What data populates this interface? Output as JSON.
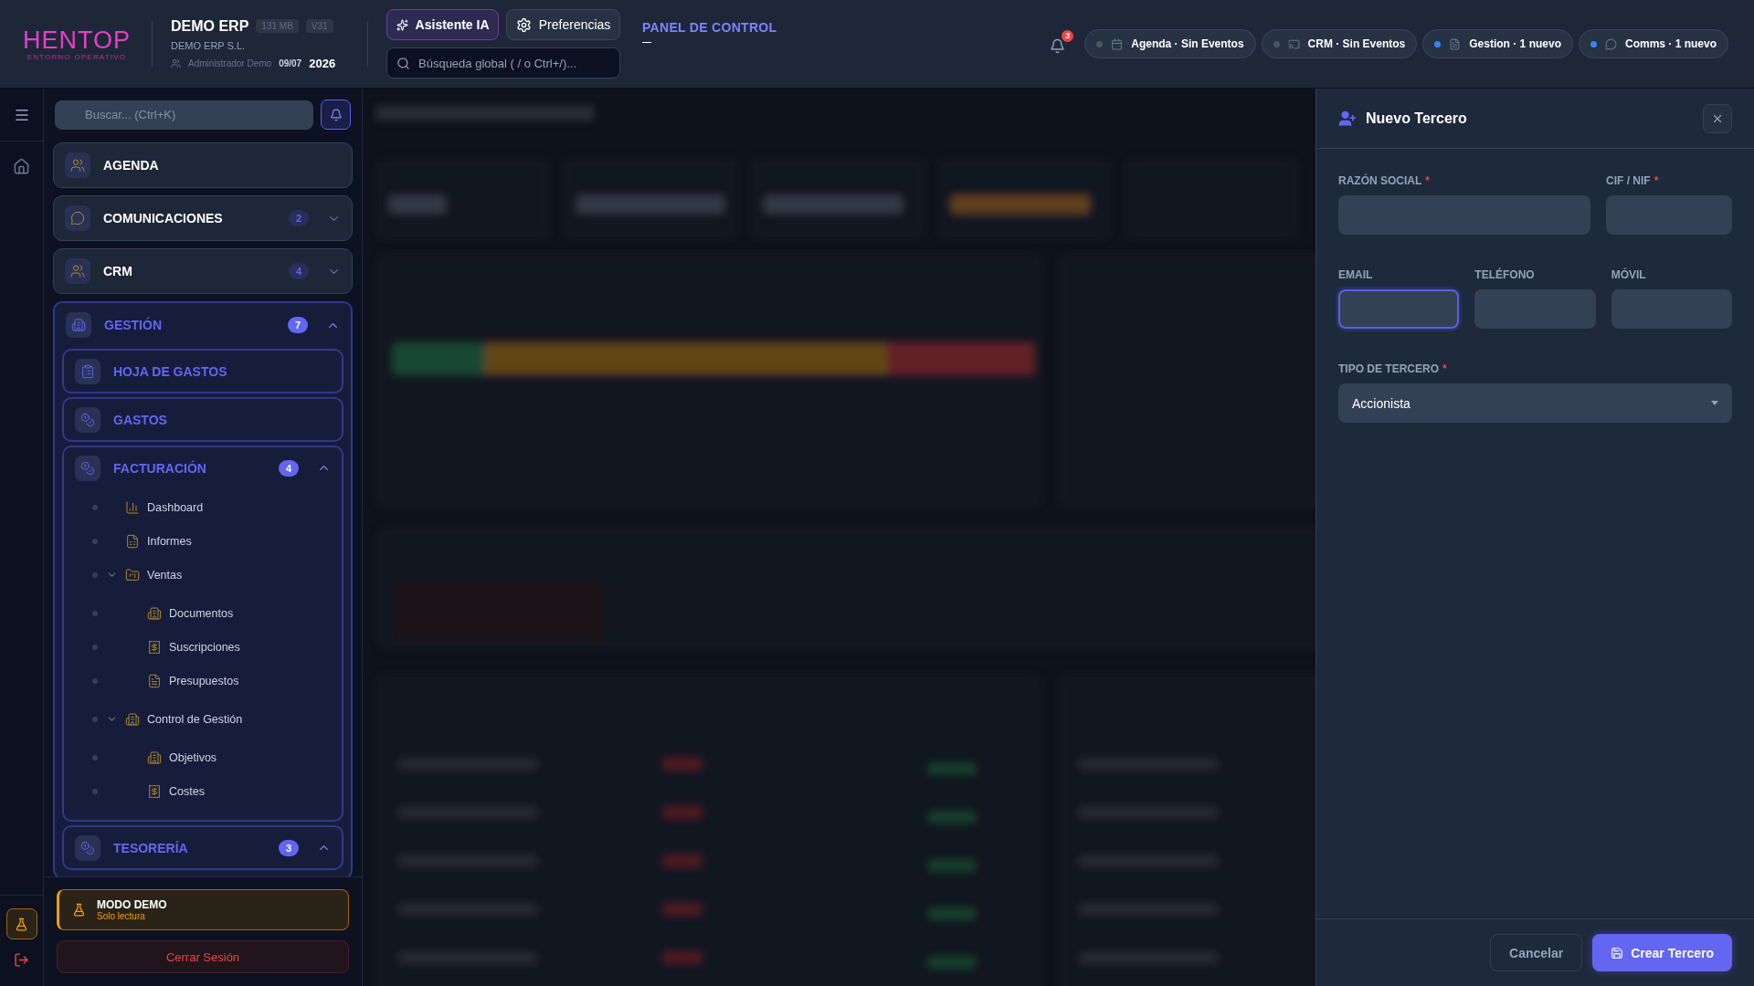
{
  "header": {
    "logo": {
      "name": "HENTOP",
      "tagline": "ENTORNO OPERATIVO"
    },
    "company": {
      "name": "DEMO ERP",
      "size": "131 MB",
      "version": "V31",
      "legal_name": "DEMO ERP S.L.",
      "user": "Administrador Demo",
      "date": "09/07",
      "year": "2026"
    },
    "assistant_button": "Asistente IA",
    "preferences_button": "Preferencias",
    "search": {
      "placeholder": "Búsqueda global ( / o Ctrl+/)..."
    },
    "panel_title": "PANEL DE CONTROL",
    "notifications": "3",
    "pills": [
      {
        "label": "Agenda · Sin Eventos",
        "active": false,
        "kind": "calendar"
      },
      {
        "label": "CRM · Sin Eventos",
        "active": false,
        "kind": "cast"
      },
      {
        "label": "Gestion · 1 nuevo",
        "active": true,
        "kind": "file"
      },
      {
        "label": "Comms · 1 nuevo",
        "active": true,
        "kind": "chat"
      }
    ]
  },
  "sidebar": {
    "search": {
      "placeholder": "Buscar... (Ctrl+K)"
    },
    "modules": [
      {
        "label": "AGENDA",
        "active": false
      },
      {
        "label": "COMUNICACIONES",
        "badge": "2",
        "active": false,
        "expanded": false
      },
      {
        "label": "CRM",
        "badge": "4",
        "active": false,
        "expanded": false
      },
      {
        "label": "GESTIÓN",
        "badge": "7",
        "active": true,
        "expanded": true,
        "children": [
          {
            "label": "HOJA DE GASTOS"
          },
          {
            "label": "GASTOS"
          },
          {
            "label": "FACTURACIÓN",
            "badge": "4",
            "expanded": true,
            "children": [
              {
                "label": "Dashboard"
              },
              {
                "label": "Informes"
              },
              {
                "label": "Ventas",
                "expanded": true,
                "children": [
                  {
                    "label": "Documentos"
                  },
                  {
                    "label": "Suscripciones"
                  },
                  {
                    "label": "Presupuestos"
                  }
                ]
              },
              {
                "label": "Control de Gestión",
                "expanded": true,
                "children": [
                  {
                    "label": "Objetivos"
                  },
                  {
                    "label": "Costes"
                  }
                ]
              }
            ]
          },
          {
            "label": "TESORERÍA",
            "badge": "3",
            "expanded": true
          }
        ]
      }
    ],
    "demo": {
      "title": "MODO DEMO",
      "subtitle": "Solo lectura"
    },
    "logout": "Cerrar Sesión"
  },
  "panel": {
    "title": "Nuevo Tercero",
    "rows": [
      {
        "fields": [
          {
            "label": "RAZÓN SOCIAL",
            "required_mark": "*",
            "focused": false
          },
          {
            "label": "CIF / NIF",
            "required_mark": "*",
            "focused": false
          }
        ]
      },
      {
        "fields": [
          {
            "label": "EMAIL",
            "focused": true
          },
          {
            "label": "TELÉFONO",
            "focused": false
          },
          {
            "label": "MÓVIL",
            "focused": false
          }
        ]
      }
    ],
    "select": {
      "label": "TIPO DE TERCERO",
      "required_mark": "*",
      "value": "Accionista"
    },
    "cancel_button": "Cancelar",
    "submit_button": "Crear Tercero"
  }
}
